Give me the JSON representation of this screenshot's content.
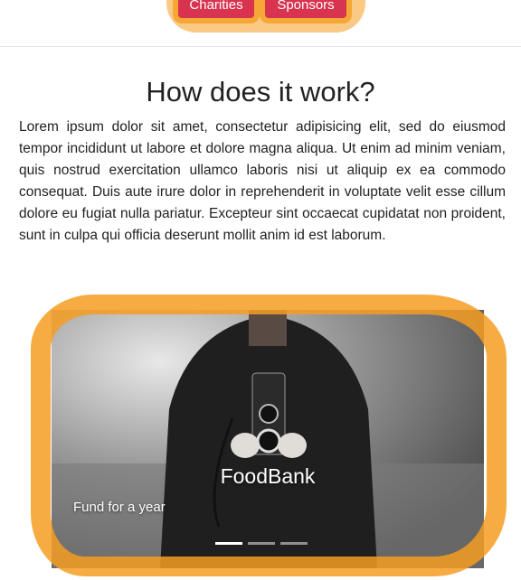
{
  "nav": {
    "charities_label": "Charities",
    "sponsors_label": "Sponsors"
  },
  "main": {
    "heading": "How does it work?",
    "body": "Lorem ipsum dolor sit amet, consectetur adipisicing elit, sed do eiusmod tempor incididunt ut labore et dolore magna aliqua. Ut enim ad minim veniam, quis nostrud exercitation ullamco laboris nisi ut aliquip ex ea commodo consequat. Duis aute irure dolor in reprehenderit in voluptate velit esse cillum dolore eu fugiat nulla pariatur. Excepteur sint occaecat cupidatat non proident, sunt in culpa qui officia deserunt mollit anim id est laborum."
  },
  "carousel": {
    "slide_title": "FoodBank",
    "slide_caption": "Fund for a year",
    "slide_count": 3,
    "active_slide": 1
  },
  "colors": {
    "nav_button": "#d8344f",
    "highlight": "#f59e21"
  }
}
